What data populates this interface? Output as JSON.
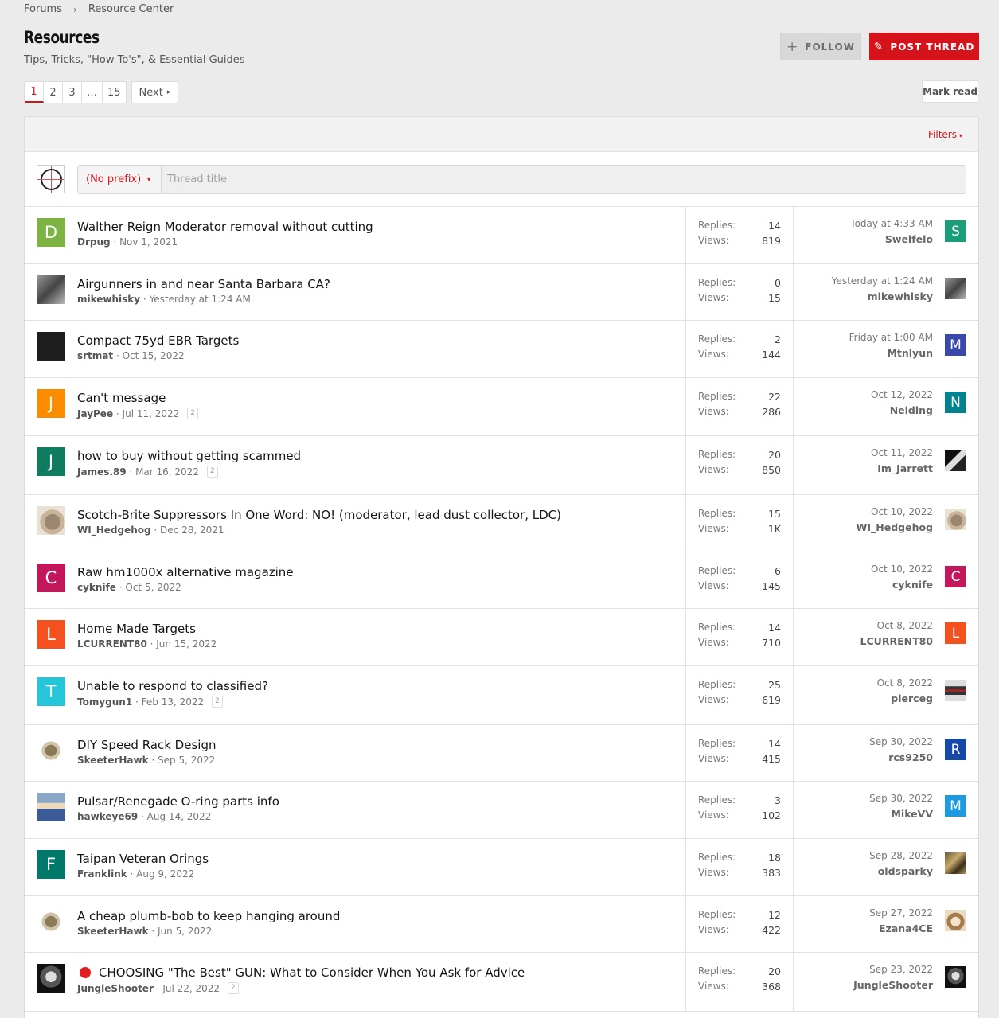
{
  "breadcrumb": {
    "forums": "Forums",
    "current": "Resource Center"
  },
  "page": {
    "title": "Resources",
    "description": "Tips, Tricks, \"How To's\", & Essential Guides"
  },
  "buttons": {
    "follow": "FOLLOW",
    "post_thread": "POST THREAD",
    "mark_read": "Mark read",
    "filters": "Filters"
  },
  "pagination": {
    "pages": [
      "1",
      "2",
      "3",
      "…",
      "15"
    ],
    "current": "1",
    "next": "Next"
  },
  "quick_thread": {
    "prefix": "(No prefix)",
    "placeholder": "Thread title"
  },
  "labels": {
    "replies": "Replies:",
    "views": "Views:"
  },
  "threads": [
    {
      "title": "Walther Reign Moderator removal without cutting",
      "author": "Drpug",
      "date": "Nov 1, 2021",
      "replies": "14",
      "views": "819",
      "last_time": "Today at 4:33 AM",
      "last_user": "Swelfelo",
      "badge": ""
    },
    {
      "title": "Airgunners in and near Santa Barbara CA?",
      "author": "mikewhisky",
      "date": "Yesterday at 1:24 AM",
      "replies": "0",
      "views": "15",
      "last_time": "Yesterday at 1:24 AM",
      "last_user": "mikewhisky",
      "badge": ""
    },
    {
      "title": "Compact 75yd EBR Targets",
      "author": "srtmat",
      "date": "Oct 15, 2022",
      "replies": "2",
      "views": "144",
      "last_time": "Friday at 1:00 AM",
      "last_user": "Mtnlyun",
      "badge": ""
    },
    {
      "title": "Can't message",
      "author": "JayPee",
      "date": "Jul 11, 2022",
      "replies": "22",
      "views": "286",
      "last_time": "Oct 12, 2022",
      "last_user": "Neiding",
      "badge": "2"
    },
    {
      "title": "how to buy without getting scammed",
      "author": "James.89",
      "date": "Mar 16, 2022",
      "replies": "20",
      "views": "850",
      "last_time": "Oct 11, 2022",
      "last_user": "Im_Jarrett",
      "badge": "2"
    },
    {
      "title": "Scotch-Brite Suppressors In One Word: NO! (moderator, lead dust collector, LDC)",
      "author": "WI_Hedgehog",
      "date": "Dec 28, 2021",
      "replies": "15",
      "views": "1K",
      "last_time": "Oct 10, 2022",
      "last_user": "WI_Hedgehog",
      "badge": ""
    },
    {
      "title": "Raw hm1000x alternative magazine",
      "author": "cyknife",
      "date": "Oct 5, 2022",
      "replies": "6",
      "views": "145",
      "last_time": "Oct 10, 2022",
      "last_user": "cyknife",
      "badge": ""
    },
    {
      "title": "Home Made Targets",
      "author": "LCURRENT80",
      "date": "Jun 15, 2022",
      "replies": "14",
      "views": "710",
      "last_time": "Oct 8, 2022",
      "last_user": "LCURRENT80",
      "badge": ""
    },
    {
      "title": "Unable to respond to classified?",
      "author": "Tomygun1",
      "date": "Feb 13, 2022",
      "replies": "25",
      "views": "619",
      "last_time": "Oct 8, 2022",
      "last_user": "pierceg",
      "badge": "2"
    },
    {
      "title": "DIY Speed Rack Design",
      "author": "SkeeterHawk",
      "date": "Sep 5, 2022",
      "replies": "14",
      "views": "415",
      "last_time": "Sep 30, 2022",
      "last_user": "rcs9250",
      "badge": ""
    },
    {
      "title": "Pulsar/Renegade O-ring parts info",
      "author": "hawkeye69",
      "date": "Aug 14, 2022",
      "replies": "3",
      "views": "102",
      "last_time": "Sep 30, 2022",
      "last_user": "MikeVV",
      "badge": ""
    },
    {
      "title": "Taipan Veteran Orings",
      "author": "Franklink",
      "date": "Aug 9, 2022",
      "replies": "18",
      "views": "383",
      "last_time": "Sep 28, 2022",
      "last_user": "oldsparky",
      "badge": ""
    },
    {
      "title": "A cheap plumb-bob to keep hanging around",
      "author": "SkeeterHawk",
      "date": "Jun 5, 2022",
      "replies": "12",
      "views": "422",
      "last_time": "Sep 27, 2022",
      "last_user": "Ezana4CE",
      "badge": ""
    },
    {
      "title": "CHOOSING \"The Best\" GUN: What to Consider When You Ask for Advice",
      "author": "JungleShooter",
      "date": "Jul 22, 2022",
      "replies": "20",
      "views": "368",
      "last_time": "Sep 23, 2022",
      "last_user": "JungleShooter",
      "badge": "2"
    }
  ],
  "avatars": {
    "author_letters": [
      "D",
      "",
      "",
      "J",
      "J",
      "",
      "C",
      "L",
      "T",
      "",
      "",
      "F",
      "",
      ""
    ],
    "last_letters": [
      "S",
      "",
      "M",
      "N",
      "",
      "",
      "C",
      "L",
      "",
      "R",
      "M",
      "",
      "",
      ""
    ],
    "sticky_icon": "red-circle-icon"
  },
  "colors": {
    "accent": "#d6131a",
    "background": "#ebebeb"
  }
}
